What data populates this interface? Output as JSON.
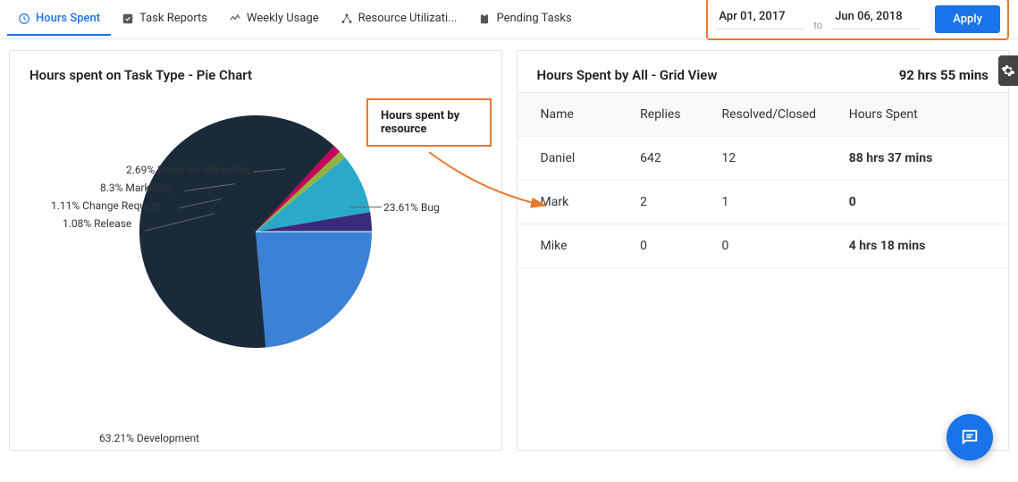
{
  "tabs": {
    "hours_spent": "Hours Spent",
    "task_reports": "Task Reports",
    "weekly_usage": "Weekly Usage",
    "resource_utilization": "Resource Utilizati...",
    "pending_tasks": "Pending Tasks"
  },
  "date_range": {
    "from": "Apr 01, 2017",
    "to_label": "to",
    "to": "Jun 06, 2018",
    "apply": "Apply"
  },
  "pie_card": {
    "title": "Hours spent on Task Type - Pie Chart",
    "annotation": "Hours spent by resource"
  },
  "chart_data": {
    "type": "pie",
    "title": "Hours spent on Task Type - Pie Chart",
    "series": [
      {
        "name": "Bug",
        "percent": 23.61,
        "color": "#3b82d6"
      },
      {
        "name": "Development",
        "percent": 63.21,
        "color": "#1a2a3a"
      },
      {
        "name": "Release",
        "percent": 1.08,
        "color": "#c3005b"
      },
      {
        "name": "Change Request",
        "percent": 1.11,
        "color": "#8fb440"
      },
      {
        "name": "Marketing",
        "percent": 8.3,
        "color": "#2aa9c9"
      },
      {
        "name": "Email for Marketing",
        "percent": 2.69,
        "color": "#3a2a7a"
      }
    ],
    "labels": {
      "bug": "23.61% Bug",
      "development": "63.21% Development",
      "release": "1.08% Release",
      "change_request": "1.11% Change Request",
      "marketing": "8.3% Marketing",
      "email_marketing": "2.69% Email for Marketing"
    }
  },
  "grid_card": {
    "title": "Hours Spent by All - Grid View",
    "total": "92 hrs 55 mins",
    "columns": {
      "name": "Name",
      "replies": "Replies",
      "resolved": "Resolved/Closed",
      "hours": "Hours Spent"
    },
    "rows": [
      {
        "name": "Daniel",
        "replies": "642",
        "resolved": "12",
        "hours": "88 hrs 37 mins"
      },
      {
        "name": "Mark",
        "replies": "2",
        "resolved": "1",
        "hours": "0"
      },
      {
        "name": "Mike",
        "replies": "0",
        "resolved": "0",
        "hours": "4 hrs 18 mins"
      }
    ]
  }
}
